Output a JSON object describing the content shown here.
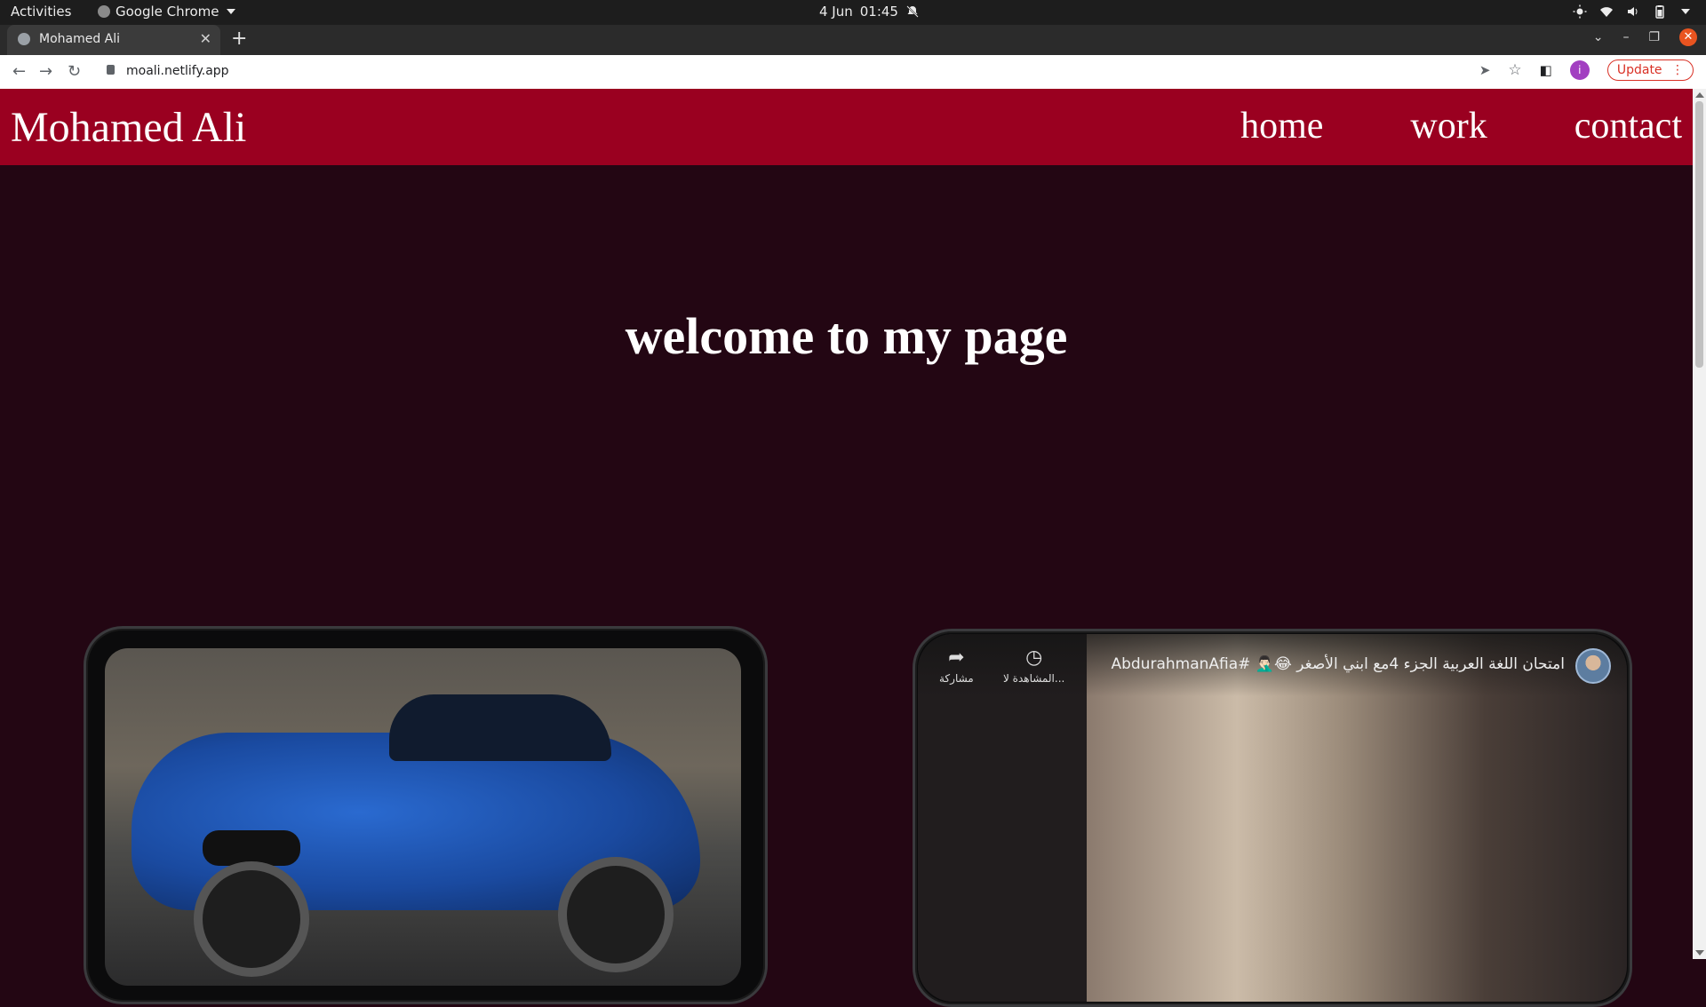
{
  "os": {
    "activities": "Activities",
    "app_name": "Google Chrome",
    "date": "4 Jun",
    "time": "01:45",
    "icons": [
      "bell-off-icon",
      "brightness-icon",
      "wifi-icon",
      "volume-icon",
      "battery-icon",
      "chevron-down-icon"
    ]
  },
  "browser": {
    "tab_title": "Mohamed Ali",
    "url": "moali.netlify.app",
    "update_label": "Update",
    "profile_initial": "i",
    "colors": {
      "update": "#d93025",
      "profile": "#a23fc1",
      "close": "#e95420"
    }
  },
  "site": {
    "brand": "Mohamed Ali",
    "nav": [
      "home",
      "work",
      "contact"
    ],
    "hero_title": "welcome to my page",
    "colors": {
      "header_bg": "#9a0020",
      "page_bg": "#230613",
      "text": "#ffffff"
    }
  },
  "video": {
    "title": "امتحان اللغة العربية الجزء 4مع ابني الأصغر 😂🤦🏻‍♂️ #AbdurahmanAfia",
    "share_label": "مشاركة",
    "watch_later_label": "المشاهدة لا..."
  }
}
